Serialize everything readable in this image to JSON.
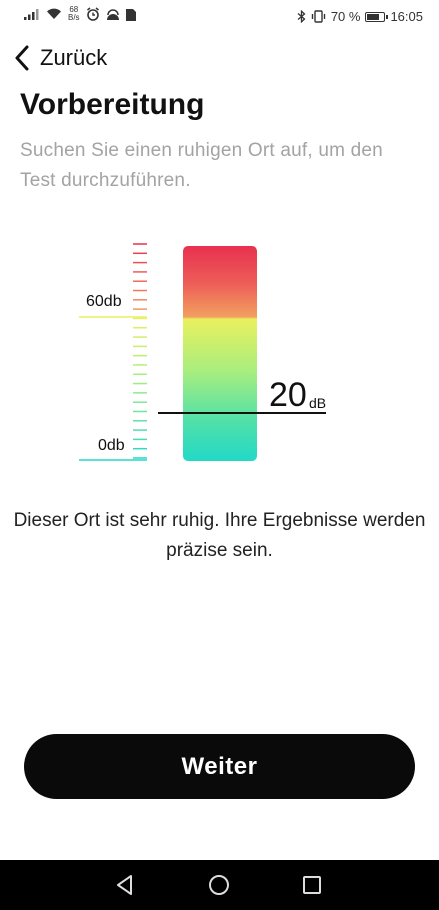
{
  "status_bar": {
    "net_speed_value": "68",
    "net_speed_unit": "B/s",
    "battery_level": "70 %",
    "battery_fraction": 0.7,
    "time": "16:05",
    "icons": [
      "signal-icon",
      "wifi-icon",
      "alarm-icon",
      "app-icon",
      "sim-card-icon",
      "bluetooth-icon",
      "vibrate-icon",
      "battery-icon"
    ]
  },
  "header": {
    "back_label": "Zurück",
    "title": "Vorbereitung",
    "subtitle": "Suchen Sie einen ruhigen Ort auf, um den Test durchzuführen."
  },
  "meter": {
    "label_high": "60db",
    "label_low": "0db",
    "reading_value": "20",
    "reading_unit": "dB",
    "colors": {
      "red": "#e8314f",
      "yellow": "#e9f05e",
      "green": "#a9ee7e",
      "cyan": "#22d9c7"
    }
  },
  "message": "Dieser Ort ist sehr ruhig. Ihre Ergebnisse werden präzise sein.",
  "continue_button": {
    "label": "Weiter"
  },
  "nav": {
    "icons": [
      "back-triangle-icon",
      "home-circle-icon",
      "recents-square-icon"
    ]
  }
}
